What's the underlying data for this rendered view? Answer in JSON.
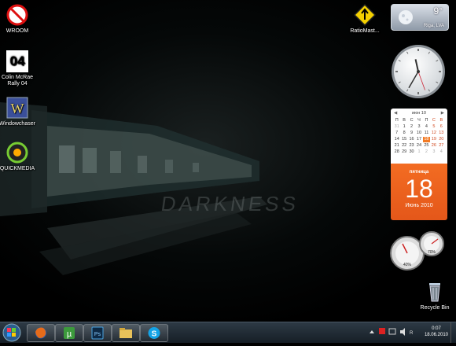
{
  "desktop_icons": [
    {
      "label": "WROOM"
    },
    {
      "label": "Colin McRae\nRally 04",
      "badge": "04"
    },
    {
      "label": "Windowchaser"
    },
    {
      "label": "QUICKMEDIA"
    },
    {
      "label": "RatioMast..."
    },
    {
      "label": "Recycle Bin"
    }
  ],
  "wallpaper": {
    "text": "DARKNESS"
  },
  "weather": {
    "temperature": "9°",
    "location": "Riga, LVA"
  },
  "calendar": {
    "month_header": "июн 10",
    "weekdays": [
      "П",
      "В",
      "С",
      "Ч",
      "П",
      "С",
      "В"
    ],
    "weeks": [
      [
        "31",
        "1",
        "2",
        "3",
        "4",
        "5",
        "6"
      ],
      [
        "7",
        "8",
        "9",
        "10",
        "11",
        "12",
        "13"
      ],
      [
        "14",
        "15",
        "16",
        "17",
        "18",
        "19",
        "20"
      ],
      [
        "21",
        "22",
        "23",
        "24",
        "25",
        "26",
        "27"
      ],
      [
        "28",
        "29",
        "30",
        "1",
        "2",
        "3",
        "4"
      ]
    ],
    "highlighted_day": "18",
    "day_of_week": "пятница",
    "day": "18",
    "month_year": "Июнь 2010"
  },
  "cpu_meter": {
    "cpu_percent": "40%",
    "memory_percent": "70%"
  },
  "clock": {
    "hour": 11,
    "minute": 35
  },
  "taskbar": {
    "time": "0:07",
    "date": "18.06.2010",
    "pinned": [
      "firefox",
      "utorrent",
      "photoshop",
      "windows-explorer",
      "skype"
    ]
  },
  "colors": {
    "accent": "#f36c22",
    "taskbar": "#1f2a34"
  }
}
